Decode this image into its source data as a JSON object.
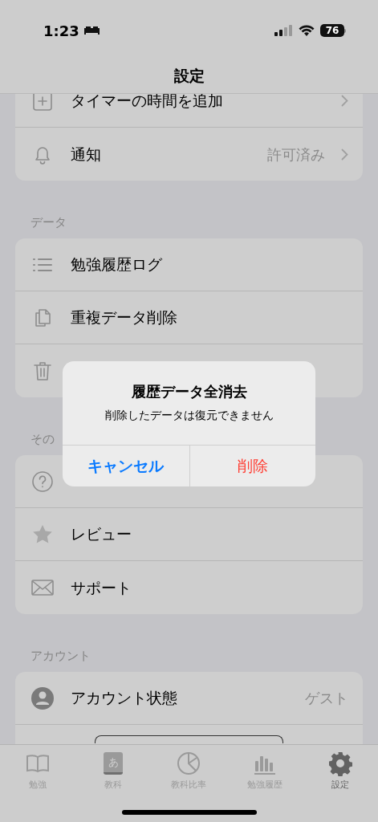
{
  "status_bar": {
    "time": "1:23",
    "battery": "76"
  },
  "nav": {
    "title": "設定"
  },
  "sections": [
    {
      "rows": [
        {
          "label": "タイマーの時間を追加",
          "chevron": true
        },
        {
          "label": "通知",
          "value": "許可済み",
          "chevron": true
        }
      ]
    },
    {
      "header": "データ",
      "rows": [
        {
          "label": "勉強履歴ログ",
          "chevron": false
        },
        {
          "label": "重複データ削除",
          "chevron": false
        },
        {
          "chevron": false
        }
      ]
    },
    {
      "header": "その",
      "rows": [
        {
          "chevron": false
        },
        {
          "label": "レビュー",
          "chevron": false
        },
        {
          "label": "サポート",
          "chevron": false
        }
      ]
    },
    {
      "header": "アカウント",
      "rows": [
        {
          "label": "アカウント状態",
          "value": "ゲスト",
          "chevron": false
        },
        {
          "kind": "button-row"
        }
      ]
    }
  ],
  "dialog": {
    "title": "履歴データ全消去",
    "message": "削除したデータは復元できません",
    "buttons": [
      {
        "label": "キャンセル",
        "kind": "cancel"
      },
      {
        "label": "削除",
        "kind": "destructive"
      }
    ]
  },
  "tabs": [
    {
      "label": "勉強",
      "selected": false
    },
    {
      "label": "教科",
      "selected": false,
      "icon_glyph": "あ"
    },
    {
      "label": "教科比率",
      "selected": false
    },
    {
      "label": "勉強履歴",
      "selected": false
    },
    {
      "label": "設定",
      "selected": true
    }
  ]
}
